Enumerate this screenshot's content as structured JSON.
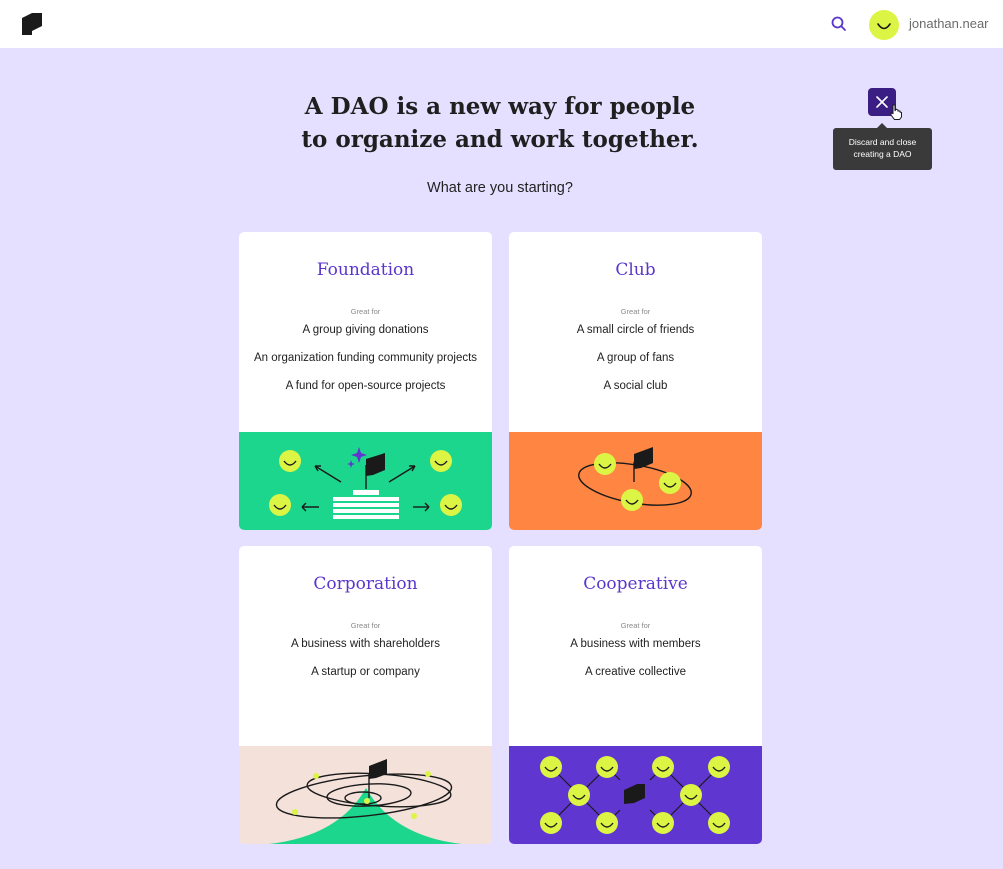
{
  "header": {
    "username": "jonathan.near",
    "logo_icon": "sputnik-flag-logo-icon",
    "search_icon": "search-icon"
  },
  "intro": {
    "headline_line1": "A DAO is a new way for people",
    "headline_line2": "to organize and work together.",
    "question": "What are you starting?"
  },
  "close": {
    "tooltip_line1": "Discard and close",
    "tooltip_line2": "creating a DAO"
  },
  "cards": [
    {
      "title": "Foundation",
      "great_for": "Great for",
      "uses": [
        "A group giving donations",
        "An organization funding community projects",
        "A fund for open-source projects"
      ],
      "illustration_color": "#1dd68d"
    },
    {
      "title": "Club",
      "great_for": "Great for",
      "uses": [
        "A small circle of friends",
        "A group of fans",
        "A social club"
      ],
      "illustration_color": "#ff8642"
    },
    {
      "title": "Corporation",
      "great_for": "Great for",
      "uses": [
        "A business with shareholders",
        "A startup or company"
      ],
      "illustration_color": "#f4e1da"
    },
    {
      "title": "Cooperative",
      "great_for": "Great for",
      "uses": [
        "A business with members",
        "A creative collective"
      ],
      "illustration_color": "#6036d0"
    }
  ],
  "colors": {
    "background": "#e5e0ff",
    "accent": "#5b36cc",
    "smiley": "#dcf545",
    "close_button": "#3b1e84"
  }
}
